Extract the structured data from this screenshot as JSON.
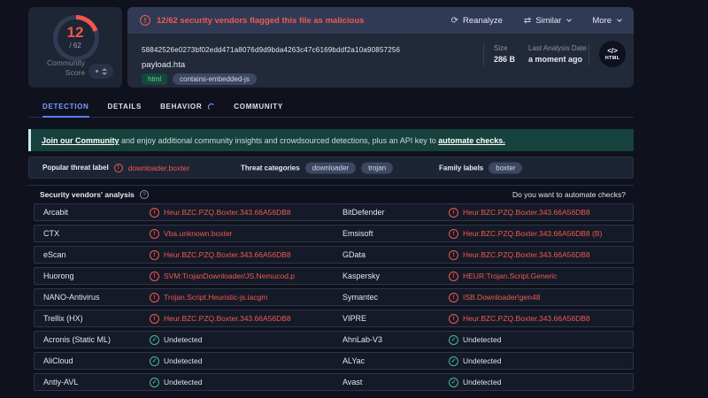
{
  "score_card": {
    "score": "12",
    "total": "/ 62",
    "label_line1": "Community",
    "label_line2": "Score"
  },
  "file_card": {
    "alert_text": "12/62 security vendors flagged this file as malicious",
    "actions": {
      "reanalyze": "Reanalyze",
      "similar": "Similar",
      "more": "More"
    },
    "hash": "58842526e0273bf02edd471a8076d9d9bda4263c47c6169bddf2a10a90857256",
    "filename": "payload.hta",
    "tags": [
      "html",
      "contains-embedded-js"
    ],
    "meta": {
      "size_label": "Size",
      "size_value": "286 B",
      "date_label": "Last Analysis Date",
      "date_value": "a moment ago",
      "filetype_code": "</>",
      "filetype_label": "HTML"
    }
  },
  "icons": {
    "reanalyze": "⟳",
    "similar": "⇄",
    "alert": "!",
    "info": "?",
    "check": "✓"
  },
  "tabs": {
    "detection": "DETECTION",
    "details": "DETAILS",
    "behavior": "BEHAVIOR",
    "community": "COMMUNITY"
  },
  "community_banner": {
    "link1": "Join our Community",
    "middle": " and enjoy additional community insights and crowdsourced detections, plus an API key to ",
    "link2": "automate checks."
  },
  "threat_row": {
    "popular_label": "Popular threat label",
    "popular_value": "downloader.boxter",
    "categories_label": "Threat categories",
    "categories": [
      "downloader",
      "trojan"
    ],
    "family_label": "Family labels",
    "families": [
      "boxter"
    ]
  },
  "vendors_header": {
    "title": "Security vendors' analysis",
    "right_text": "Do you want to automate checks?"
  },
  "colors": {
    "accent_red": "#ee5a50",
    "accent_teal": "#49b89a",
    "tab_active_blue": "#7e9cff",
    "banner_teal_bg": "#16413d",
    "card_bg": "#222938",
    "page_bg": "#0f121d"
  },
  "table": {
    "rows": [
      {
        "left": {
          "vendor": "Arcabit",
          "result": "Heur.BZC.PZQ.Boxter.343.66A56DB8",
          "status": "malicious"
        },
        "right": {
          "vendor": "BitDefender",
          "result": "Heur.BZC.PZQ.Boxter.343.66A56DB8",
          "status": "malicious"
        }
      },
      {
        "left": {
          "vendor": "CTX",
          "result": "Vba.unknown.boxter",
          "status": "malicious"
        },
        "right": {
          "vendor": "Emsisoft",
          "result": "Heur.BZC.PZQ.Boxter.343.66A56DB8 (B)",
          "status": "malicious"
        }
      },
      {
        "left": {
          "vendor": "eScan",
          "result": "Heur.BZC.PZQ.Boxter.343.66A56DB8",
          "status": "malicious"
        },
        "right": {
          "vendor": "GData",
          "result": "Heur.BZC.PZQ.Boxter.343.66A56DB8",
          "status": "malicious"
        }
      },
      {
        "left": {
          "vendor": "Huorong",
          "result": "SVM:TrojanDownloader/JS.Nemucod.p",
          "status": "malicious"
        },
        "right": {
          "vendor": "Kaspersky",
          "result": "HEUR:Trojan.Script.Generic",
          "status": "malicious"
        }
      },
      {
        "left": {
          "vendor": "NANO-Antivirus",
          "result": "Trojan.Script.Heuristic-js.iacgm",
          "status": "malicious"
        },
        "right": {
          "vendor": "Symantec",
          "result": "ISB.Downloader!gen48",
          "status": "malicious"
        }
      },
      {
        "left": {
          "vendor": "Trellix (HX)",
          "result": "Heur.BZC.PZQ.Boxter.343.66A56DB8",
          "status": "malicious"
        },
        "right": {
          "vendor": "VIPRE",
          "result": "Heur.BZC.PZQ.Boxter.343.66A56DB8",
          "status": "malicious"
        }
      },
      {
        "left": {
          "vendor": "Acronis (Static ML)",
          "result": "Undetected",
          "status": "clean"
        },
        "right": {
          "vendor": "AhnLab-V3",
          "result": "Undetected",
          "status": "clean"
        }
      },
      {
        "left": {
          "vendor": "AliCloud",
          "result": "Undetected",
          "status": "clean"
        },
        "right": {
          "vendor": "ALYac",
          "result": "Undetected",
          "status": "clean"
        }
      },
      {
        "left": {
          "vendor": "Antiy-AVL",
          "result": "Undetected",
          "status": "clean"
        },
        "right": {
          "vendor": "Avast",
          "result": "Undetected",
          "status": "clean"
        }
      }
    ]
  }
}
